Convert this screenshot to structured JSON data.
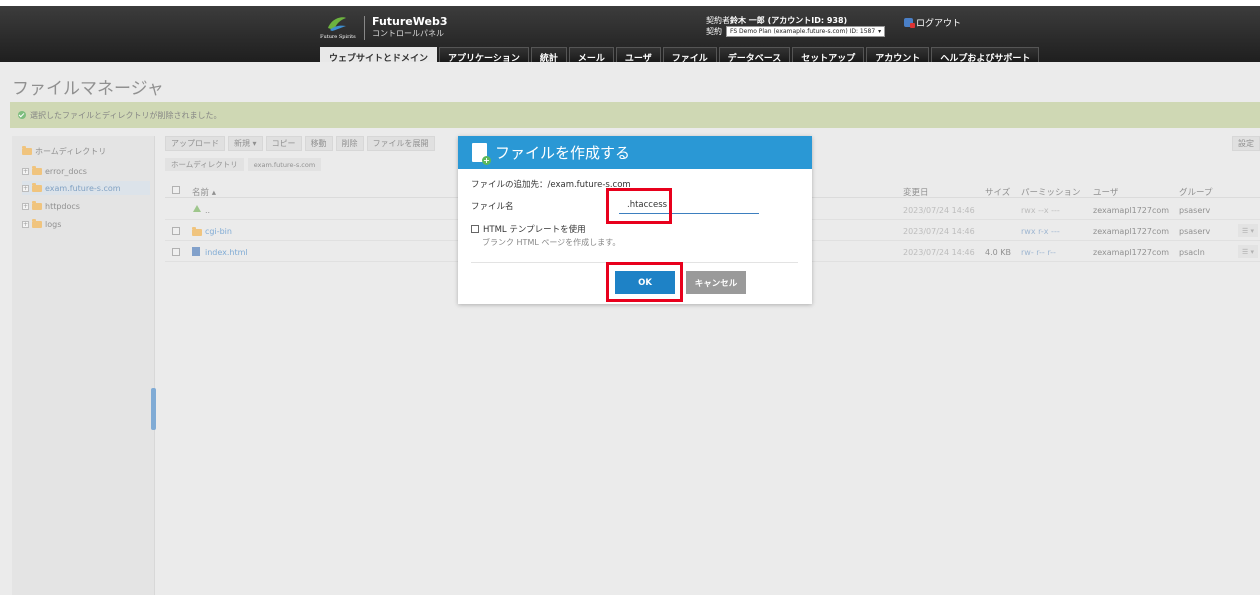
{
  "header": {
    "logo_text": "Future Spirits",
    "brand_name": "FutureWeb3",
    "brand_sub": "コントロールパネル",
    "account_prefix": "契約者",
    "account_name": "鈴木 一郎 (アカウントID: 938)",
    "contract_label": "契約",
    "contract_value": "FS Demo Plan (examaple.future-s.com) ID: 1587",
    "logout_label": "ログアウト"
  },
  "nav": {
    "tabs": [
      {
        "label": "ウェブサイトとドメイン"
      },
      {
        "label": "アプリケーション"
      },
      {
        "label": "統計"
      },
      {
        "label": "メール"
      },
      {
        "label": "ユーザ"
      },
      {
        "label": "ファイル"
      },
      {
        "label": "データベース"
      },
      {
        "label": "セットアップ"
      },
      {
        "label": "アカウント"
      },
      {
        "label": "ヘルプおよびサポート"
      }
    ]
  },
  "page": {
    "title": "ファイルマネージャ",
    "notice": "選択したファイルとディレクトリが削除されました。"
  },
  "tree": {
    "root": "ホームディレクトリ",
    "items": [
      {
        "label": "error_docs"
      },
      {
        "label": "exam.future-s.com"
      },
      {
        "label": "httpdocs"
      },
      {
        "label": "logs"
      }
    ]
  },
  "toolbar": {
    "upload": "アップロード",
    "new": "新規",
    "copy": "コピー",
    "move": "移動",
    "delete": "削除",
    "extract": "ファイルを展開",
    "settings": "設定"
  },
  "breadcrumb": {
    "home": "ホームディレクトリ",
    "current": "exam.future-s.com"
  },
  "table": {
    "headers": {
      "name": "名前 ▴",
      "modified": "変更日",
      "size": "サイズ",
      "permission": "パーミッション",
      "user": "ユーザ",
      "group": "グループ"
    },
    "rows": [
      {
        "name": "..",
        "modified": "2023/07/24 14:46",
        "size": "",
        "permission": "rwx --x ---",
        "user": "zexamapl1727com",
        "group": "psaserv"
      },
      {
        "name": "cgi-bin",
        "modified": "2023/07/24 14:46",
        "size": "",
        "permission": "rwx r-x ---",
        "user": "zexamapl1727com",
        "group": "psaserv"
      },
      {
        "name": "index.html",
        "modified": "2023/07/24 14:46",
        "size": "4.0 KB",
        "permission": "rw- r-- r--",
        "user": "zexamapl1727com",
        "group": "psacln"
      }
    ]
  },
  "modal": {
    "title": "ファイルを作成する",
    "dest_label": "ファイルの追加先：",
    "dest_path": "/exam.future-s.com",
    "filename_label": "ファイル名",
    "filename_value": ".htaccess",
    "template_label": "HTML テンプレートを使用",
    "template_desc": "ブランク HTML ページを作成します。",
    "ok_label": "OK",
    "cancel_label": "キャンセル"
  },
  "colors": {
    "accent": "#2a98d5",
    "ok_button": "#1e82c6",
    "highlight": "#e8001c",
    "notice_bg": "#b6c48c"
  }
}
